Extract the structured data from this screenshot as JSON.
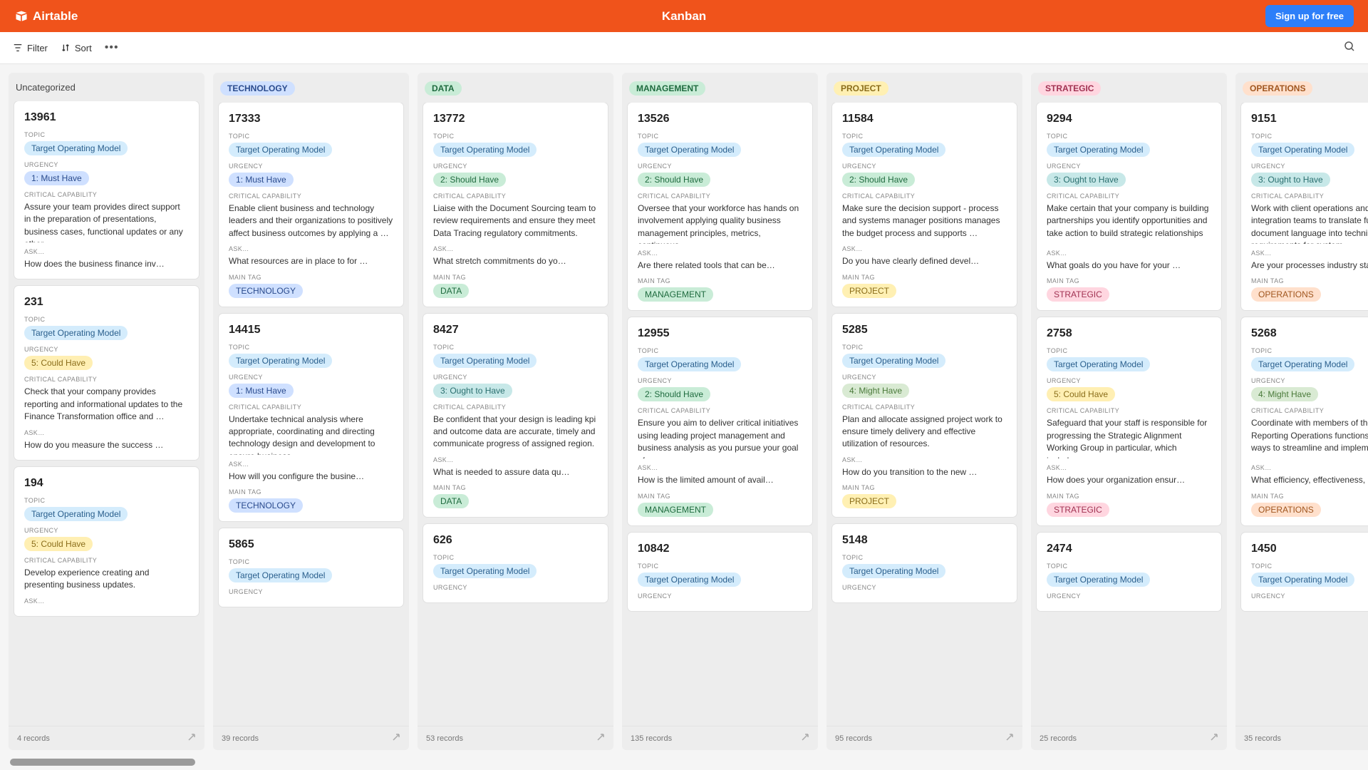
{
  "brand": "Airtable",
  "title": "Kanban",
  "signup": "Sign up for free",
  "toolbar": {
    "filter": "Filter",
    "sort": "Sort"
  },
  "labels": {
    "topic": "TOPIC",
    "urgency": "URGENCY",
    "critical": "CRITICAL CAPABILITY",
    "ask": "ASK…",
    "maintag": "MAIN TAG"
  },
  "urgency": {
    "must": "1: Must Have",
    "should": "2: Should Have",
    "ought": "3: Ought to Have",
    "might": "4: Might Have",
    "could": "5: Could Have"
  },
  "topic_value": "Target Operating Model",
  "columns": [
    {
      "name": "Uncategorized",
      "plain": true,
      "count": "4 records",
      "cards": [
        {
          "id": "13961",
          "urg": "must",
          "crit": "Assure your team provides direct support in the preparation of presentations, business cases, functional updates or any other …",
          "ask": "How does the business finance inv…"
        },
        {
          "id": "231",
          "urg": "could",
          "crit": "Check that your company provides reporting and informational updates to the Finance Transformation office and …",
          "ask": "How do you measure the success …"
        },
        {
          "id": "194",
          "urg": "could",
          "crit": "Develop experience creating and presenting business updates.",
          "ask": ""
        }
      ]
    },
    {
      "name": "TECHNOLOGY",
      "cls": "tag-tech",
      "count": "39 records",
      "cards": [
        {
          "id": "17333",
          "urg": "must",
          "crit": "Enable client business and technology leaders and their organizations to positively affect business outcomes by applying a …",
          "ask": "What resources are in place to for …",
          "tag": "TECHNOLOGY"
        },
        {
          "id": "14415",
          "urg": "must",
          "crit": "Undertake technical analysis where appropriate, coordinating and directing technology design and development to ensure business …",
          "ask": "How will you configure the busine…",
          "tag": "TECHNOLOGY"
        },
        {
          "id": "5865",
          "urg": "",
          "crit": "",
          "ask": "",
          "topic_only": true
        }
      ]
    },
    {
      "name": "DATA",
      "cls": "tag-data",
      "count": "53 records",
      "cards": [
        {
          "id": "13772",
          "urg": "should",
          "crit": "Liaise with the Document Sourcing team to review requirements and ensure they meet Data Tracing regulatory commitments.",
          "ask": "What stretch commitments do yo…",
          "tag": "DATA"
        },
        {
          "id": "8427",
          "urg": "ought",
          "crit": "Be confident that your design is leading kpi and outcome data are accurate, timely and communicate progress of assigned region.",
          "ask": "What is needed to assure data qu…",
          "tag": "DATA"
        },
        {
          "id": "626",
          "urg": "",
          "crit": "",
          "ask": "",
          "topic_only": true
        }
      ]
    },
    {
      "name": "MANAGEMENT",
      "cls": "tag-mgmt",
      "count": "135 records",
      "cards": [
        {
          "id": "13526",
          "urg": "should",
          "crit": "Oversee that your workforce has hands on involvement applying quality business management principles, metrics, continuous …",
          "ask": "Are there related tools that can be…",
          "tag": "MANAGEMENT"
        },
        {
          "id": "12955",
          "urg": "should",
          "crit": "Ensure you aim to deliver critical initiatives using leading project management and business analysis as you pursue your goal of …",
          "ask": "How is the limited amount of avail…",
          "tag": "MANAGEMENT"
        },
        {
          "id": "10842",
          "urg": "",
          "crit": "",
          "ask": "",
          "topic_only": true
        }
      ]
    },
    {
      "name": "PROJECT",
      "cls": "tag-proj",
      "count": "95 records",
      "cards": [
        {
          "id": "11584",
          "urg": "should",
          "crit": "Make sure the decision support - process and systems manager positions manages the budget process and supports …",
          "ask": "Do you have clearly defined devel…",
          "tag": "PROJECT"
        },
        {
          "id": "5285",
          "urg": "might",
          "crit": "Plan and allocate assigned project work to ensure timely delivery and effective utilization of resources.",
          "ask": "How do you transition to the new …",
          "tag": "PROJECT"
        },
        {
          "id": "5148",
          "urg": "",
          "crit": "",
          "ask": "",
          "topic_only": true
        }
      ]
    },
    {
      "name": "STRATEGIC",
      "cls": "tag-strat",
      "count": "25 records",
      "cards": [
        {
          "id": "9294",
          "urg": "ought",
          "crit": "Make certain that your company is building partnerships you identify opportunities and take action to build strategic relationships …",
          "ask": "What goals do you have for your …",
          "tag": "STRATEGIC"
        },
        {
          "id": "2758",
          "urg": "could",
          "crit": "Safeguard that your staff is responsible for progressing the Strategic Alignment Working Group in particular, which includes.",
          "ask": "How does your organization ensur…",
          "tag": "STRATEGIC"
        },
        {
          "id": "2474",
          "urg": "",
          "crit": "",
          "ask": "",
          "topic_only": true
        }
      ]
    },
    {
      "name": "OPERATIONS",
      "cls": "tag-ops",
      "count": "35 records",
      "cards": [
        {
          "id": "9151",
          "urg": "ought",
          "crit": "Work with client operations and client integration teams to translate fund document language into technical requirements for system …",
          "ask": "Are your processes industry stand…",
          "tag": "OPERATIONS"
        },
        {
          "id": "5268",
          "urg": "might",
          "crit": "Coordinate with members of the various Reporting Operations functions to identify ways to streamline and implement action …",
          "ask": "What efficiency, effectiveness, risk,…",
          "tag": "OPERATIONS"
        },
        {
          "id": "1450",
          "urg": "",
          "crit": "",
          "ask": "",
          "topic_only": true
        }
      ]
    }
  ]
}
